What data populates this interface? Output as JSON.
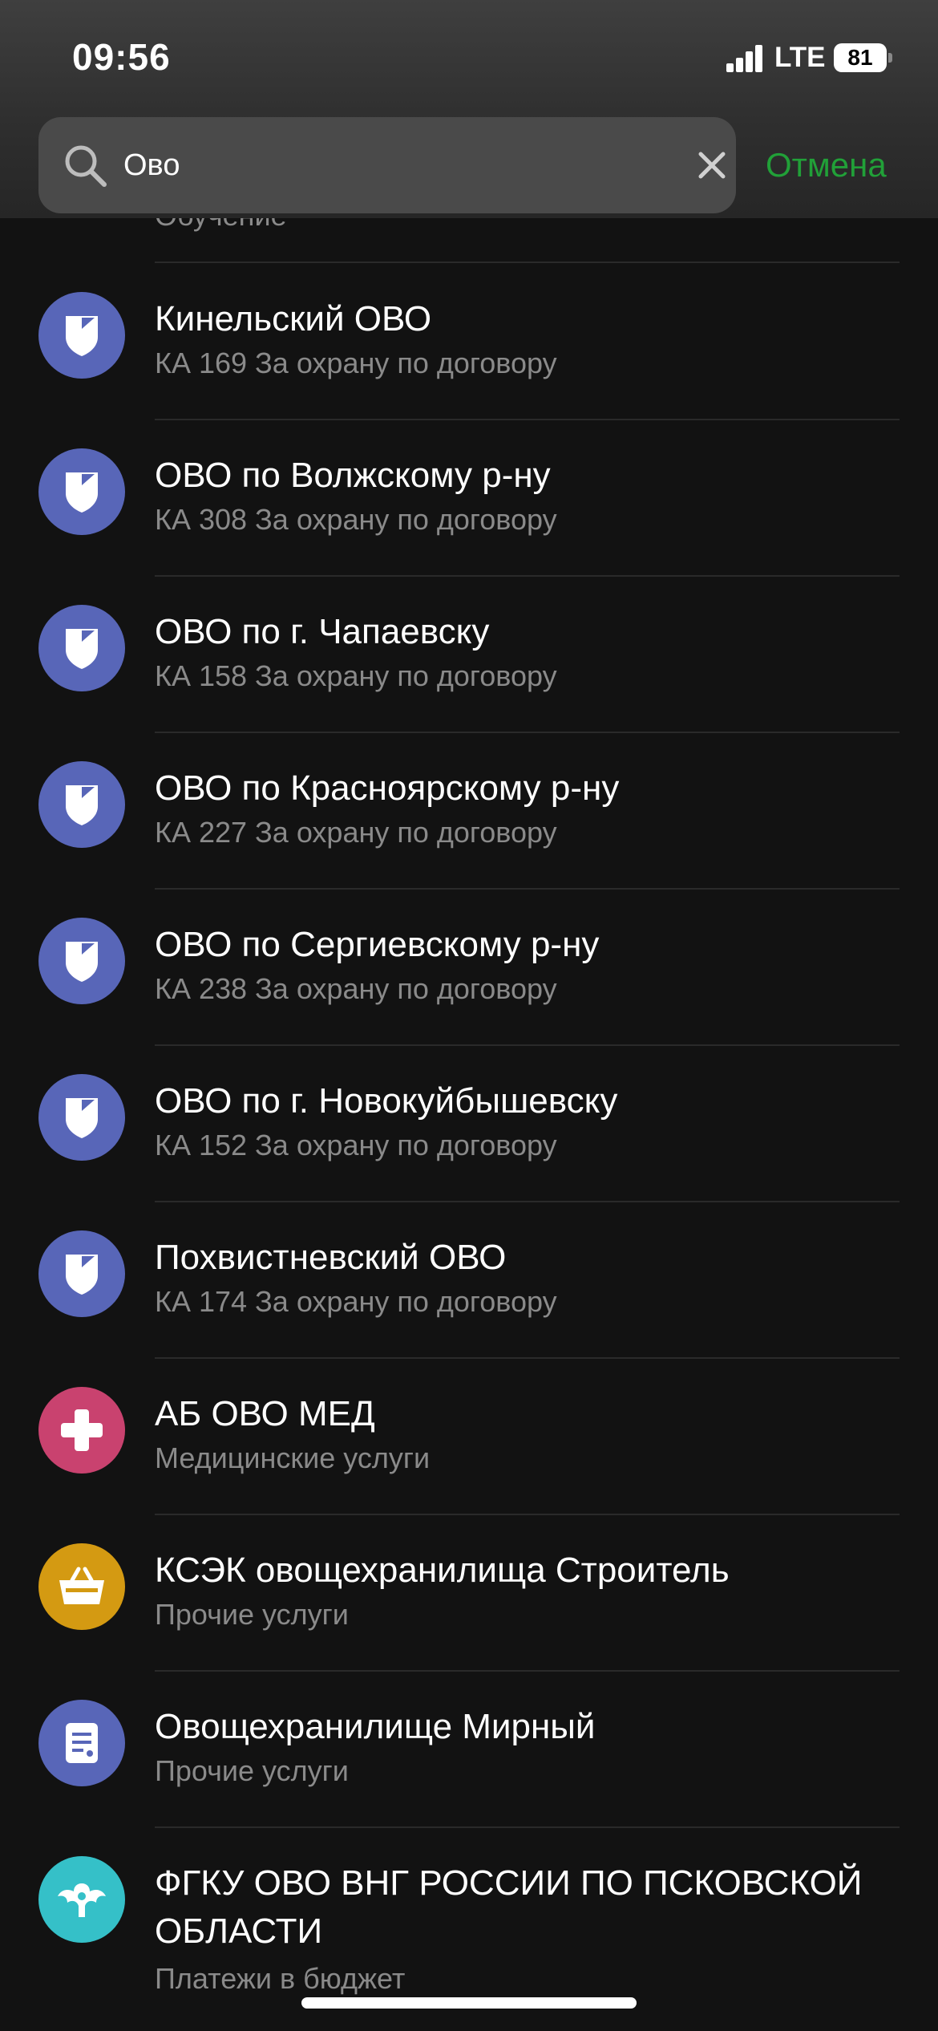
{
  "status_bar": {
    "time": "09:56",
    "network": "LTE",
    "battery": "81"
  },
  "search": {
    "value": "Ово",
    "cancel_label": "Отмена"
  },
  "partial_item": {
    "subtitle": "Обучение"
  },
  "colors": {
    "accent_green": "#21a038",
    "shield_blue": "#5866b8",
    "medical_pink": "#c9426f",
    "basket_yellow": "#d49a12",
    "budget_teal": "#35c0c8"
  },
  "items": [
    {
      "title": "Кинельский ОВО",
      "subtitle": "КА 169 За охрану по договору",
      "icon": "shield-icon"
    },
    {
      "title": "ОВО по Волжскому р-ну",
      "subtitle": "КА 308 За охрану по договору",
      "icon": "shield-icon"
    },
    {
      "title": "ОВО по г. Чапаевску",
      "subtitle": "КА 158 За охрану по договору",
      "icon": "shield-icon"
    },
    {
      "title": "ОВО по Красноярскому р-ну",
      "subtitle": "КА 227 За охрану по договору",
      "icon": "shield-icon"
    },
    {
      "title": "ОВО по Сергиевскому р-ну",
      "subtitle": "КА 238 За охрану по договору",
      "icon": "shield-icon"
    },
    {
      "title": "ОВО по г. Новокуйбышевску",
      "subtitle": "КА 152 За охрану по договору",
      "icon": "shield-icon"
    },
    {
      "title": "Похвистневский ОВО",
      "subtitle": "КА 174 За охрану по договору",
      "icon": "shield-icon"
    },
    {
      "title": "АБ ОВО МЕД",
      "subtitle": "Медицинские услуги",
      "icon": "medical-cross-icon"
    },
    {
      "title": "КСЭК овощехранилища Строитель",
      "subtitle": "Прочие услуги",
      "icon": "basket-icon"
    },
    {
      "title": "Овощехранилище Мирный",
      "subtitle": "Прочие услуги",
      "icon": "document-icon"
    },
    {
      "title": "ФГКУ ОВО ВНГ РОССИИ ПО ПСКОВСКОЙ ОБЛАСТИ",
      "subtitle": "Платежи в бюджет",
      "icon": "eagle-emblem-icon"
    }
  ]
}
